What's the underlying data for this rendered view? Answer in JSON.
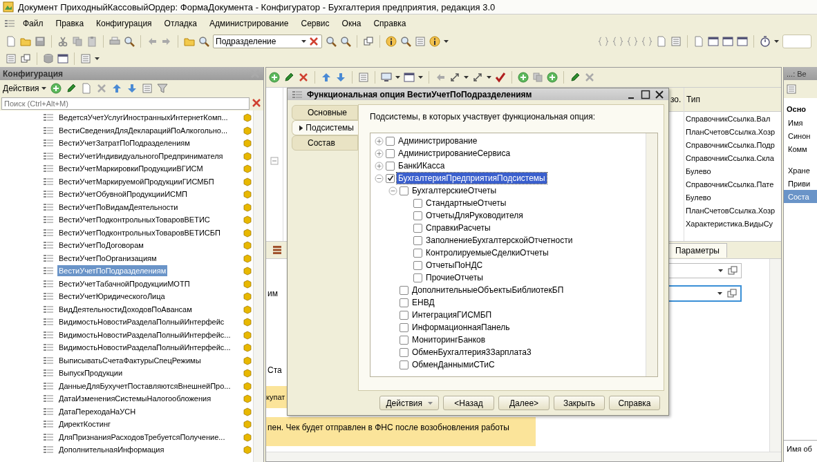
{
  "window": {
    "title": "Документ ПриходныйКассовыйОрдер: ФормаДокумента - Конфигуратор - Бухгалтерия предприятия, редакция 3.0"
  },
  "menu": [
    "Файл",
    "Правка",
    "Конфигурация",
    "Отладка",
    "Администрирование",
    "Сервис",
    "Окна",
    "Справка"
  ],
  "toolbar_search": {
    "value": "Подразделение"
  },
  "config_panel": {
    "title": "Конфигурация",
    "actions_label": "Действия",
    "search_placeholder": "Поиск (Ctrl+Alt+M)",
    "items": [
      {
        "label": "ВедетсяУчетУслугИностранныхИнтернетКомп...",
        "selected": false
      },
      {
        "label": "ВестиСведенияДляДекларацийПоАлкогольно...",
        "selected": false
      },
      {
        "label": "ВестиУчетЗатратПоПодразделениям",
        "selected": false
      },
      {
        "label": "ВестиУчетИндивидуальногоПредпринимателя",
        "selected": false
      },
      {
        "label": "ВестиУчетМаркировкиПродукцииВГИСМ",
        "selected": false
      },
      {
        "label": "ВестиУчетМаркируемойПродукцииГИСМБП",
        "selected": false
      },
      {
        "label": "ВестиУчетОбувнойПродукцииИСМП",
        "selected": false
      },
      {
        "label": "ВестиУчетПоВидамДеятельности",
        "selected": false
      },
      {
        "label": "ВестиУчетПодконтрольныхТоваровВЕТИС",
        "selected": false
      },
      {
        "label": "ВестиУчетПодконтрольныхТоваровВЕТИСБП",
        "selected": false
      },
      {
        "label": "ВестиУчетПоДоговорам",
        "selected": false
      },
      {
        "label": "ВестиУчетПоОрганизациям",
        "selected": false
      },
      {
        "label": "ВестиУчетПоПодразделениям",
        "selected": true
      },
      {
        "label": "ВестиУчетТабачнойПродукцииМОТП",
        "selected": false
      },
      {
        "label": "ВестиУчетЮридическогоЛица",
        "selected": false
      },
      {
        "label": "ВидДеятельностиДоходовПоАвансам",
        "selected": false
      },
      {
        "label": "ВидимостьНовостиРазделаПолныйИнтерфейс",
        "selected": false
      },
      {
        "label": "ВидимостьНовостиРазделаПолныйИнтерфейс...",
        "selected": false
      },
      {
        "label": "ВидимостьНовостиРазделаПолныйИнтерфейс...",
        "selected": false
      },
      {
        "label": "ВыписыватьСчетаФактурыСпецРежимы",
        "selected": false
      },
      {
        "label": "ВыпускПродукции",
        "selected": false
      },
      {
        "label": "ДанныеДляБухучетПоставляютсяВнешнейПро...",
        "selected": false
      },
      {
        "label": "ДатаИзмененияСистемыНалогообложения",
        "selected": false
      },
      {
        "label": "ДатаПереходаНаУСН",
        "selected": false
      },
      {
        "label": "ДиректКостинг",
        "selected": false
      },
      {
        "label": "ДляПризнанияРасходовТребуетсяПолучение...",
        "selected": false
      },
      {
        "label": "ДополнительнаяИнформация",
        "selected": false
      }
    ]
  },
  "editor": {
    "columns": [
      "зо.",
      "Тип"
    ],
    "types": [
      "СправочникСсылка.Вал",
      "ПланСчетовСсылка.Хозр",
      "СправочникСсылка.Подр",
      "СправочникСсылка.Скла",
      "Булево",
      "СправочникСсылка.Пате",
      "Булево",
      "ПланСчетовСсылка.Хозр",
      "Характеристика.ВидыСу"
    ],
    "tab": "Параметры",
    "field_label": "им",
    "row_label": "Ста",
    "note_fragment": "купат",
    "message": "пен. Чек будет отправлен в ФНС после возобновления работы"
  },
  "properties": {
    "title": "...: Ве",
    "section": "Осно",
    "groups": [
      [
        {
          "label": "Имя",
          "selected": false
        },
        {
          "label": "Синон",
          "selected": false
        },
        {
          "label": "Комм",
          "selected": false
        }
      ],
      [
        {
          "label": "Хране",
          "selected": false
        },
        {
          "label": "Приви",
          "selected": false
        },
        {
          "label": "Соста",
          "selected": true
        }
      ]
    ],
    "footer": "Имя об"
  },
  "dialog": {
    "title": "Функциональная опция ВестиУчетПоПодразделениям",
    "tabs": [
      {
        "label": "Основные",
        "selected": false
      },
      {
        "label": "Подсистемы",
        "selected": true
      },
      {
        "label": "Состав",
        "selected": false
      }
    ],
    "caption": "Подсистемы, в которых участвует функциональная опция:",
    "tree": [
      {
        "label": "Администрирование",
        "checked": false,
        "selected": false,
        "expanded": false
      },
      {
        "label": "АдминистрированиеСервиса",
        "checked": false,
        "selected": false,
        "expanded": false
      },
      {
        "label": "БанкИКасса",
        "checked": false,
        "selected": false,
        "expanded": false
      },
      {
        "label": "БухгалтерияПредприятияПодсистемы",
        "checked": true,
        "selected": true,
        "expanded": true,
        "children": [
          {
            "label": "БухгалтерскиеОтчеты",
            "checked": false,
            "selected": false,
            "expanded": true,
            "children": [
              {
                "label": "СтандартныеОтчеты",
                "checked": false,
                "selected": false
              },
              {
                "label": "ОтчетыДляРуководителя",
                "checked": false,
                "selected": false
              },
              {
                "label": "СправкиРасчеты",
                "checked": false,
                "selected": false
              },
              {
                "label": "ЗаполнениеБухгалтерскойОтчетности",
                "checked": false,
                "selected": false
              },
              {
                "label": "КонтролируемыеСделкиОтчеты",
                "checked": false,
                "selected": false
              },
              {
                "label": "ОтчетыПоНДС",
                "checked": false,
                "selected": false
              },
              {
                "label": "ПрочиеОтчеты",
                "checked": false,
                "selected": false
              }
            ]
          },
          {
            "label": "ДополнительныеОбъектыБиблиотекБП",
            "checked": false,
            "selected": false
          },
          {
            "label": "ЕНВД",
            "checked": false,
            "selected": false
          },
          {
            "label": "ИнтеграцияГИСМБП",
            "checked": false,
            "selected": false
          },
          {
            "label": "ИнформационнаяПанель",
            "checked": false,
            "selected": false
          },
          {
            "label": "МониторингБанков",
            "checked": false,
            "selected": false
          },
          {
            "label": "ОбменБухгалтерия3Зарплата3",
            "checked": false,
            "selected": false
          },
          {
            "label": "ОбменДаннымиСТиС",
            "checked": false,
            "selected": false
          }
        ]
      }
    ],
    "buttons": [
      {
        "label": "Действия",
        "kind": "menu"
      },
      {
        "label": "<Назад",
        "kind": "plain"
      },
      {
        "label": "Далее>",
        "kind": "plain"
      },
      {
        "label": "Закрыть",
        "kind": "plain"
      },
      {
        "label": "Справка",
        "kind": "plain"
      }
    ]
  }
}
